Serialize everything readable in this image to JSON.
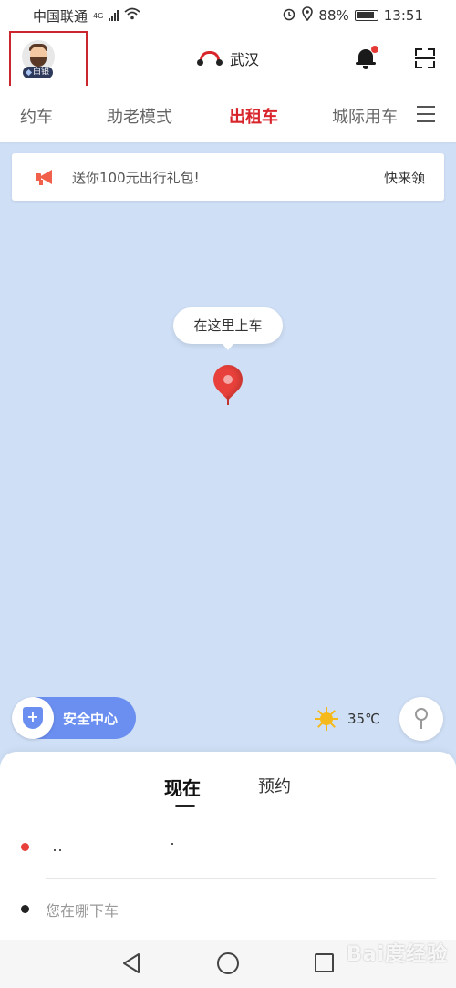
{
  "status_bar": {
    "carrier": "中国联通",
    "network": "4G",
    "battery": "88%",
    "time": "13:51"
  },
  "header": {
    "member_level": "白银",
    "city": "武汉"
  },
  "tabs": [
    {
      "label": "约车",
      "active": false
    },
    {
      "label": "助老模式",
      "active": false
    },
    {
      "label": "出租车",
      "active": true
    },
    {
      "label": "城际用车",
      "active": false
    }
  ],
  "banner": {
    "text": "送你100元出行礼包!",
    "action": "快来领"
  },
  "map": {
    "pickup_hint": "在这里上车",
    "safety_center": "安全中心",
    "temperature": "35℃"
  },
  "booking": {
    "mode_now": "现在",
    "mode_reserve": "预约",
    "pickup_value": "",
    "destination_placeholder": "您在哪下车"
  },
  "watermark": "Bai度经验",
  "colors": {
    "brand_red": "#d8242b",
    "map_background": "#cfdff5",
    "safety_blue": "#6b8ff0"
  }
}
